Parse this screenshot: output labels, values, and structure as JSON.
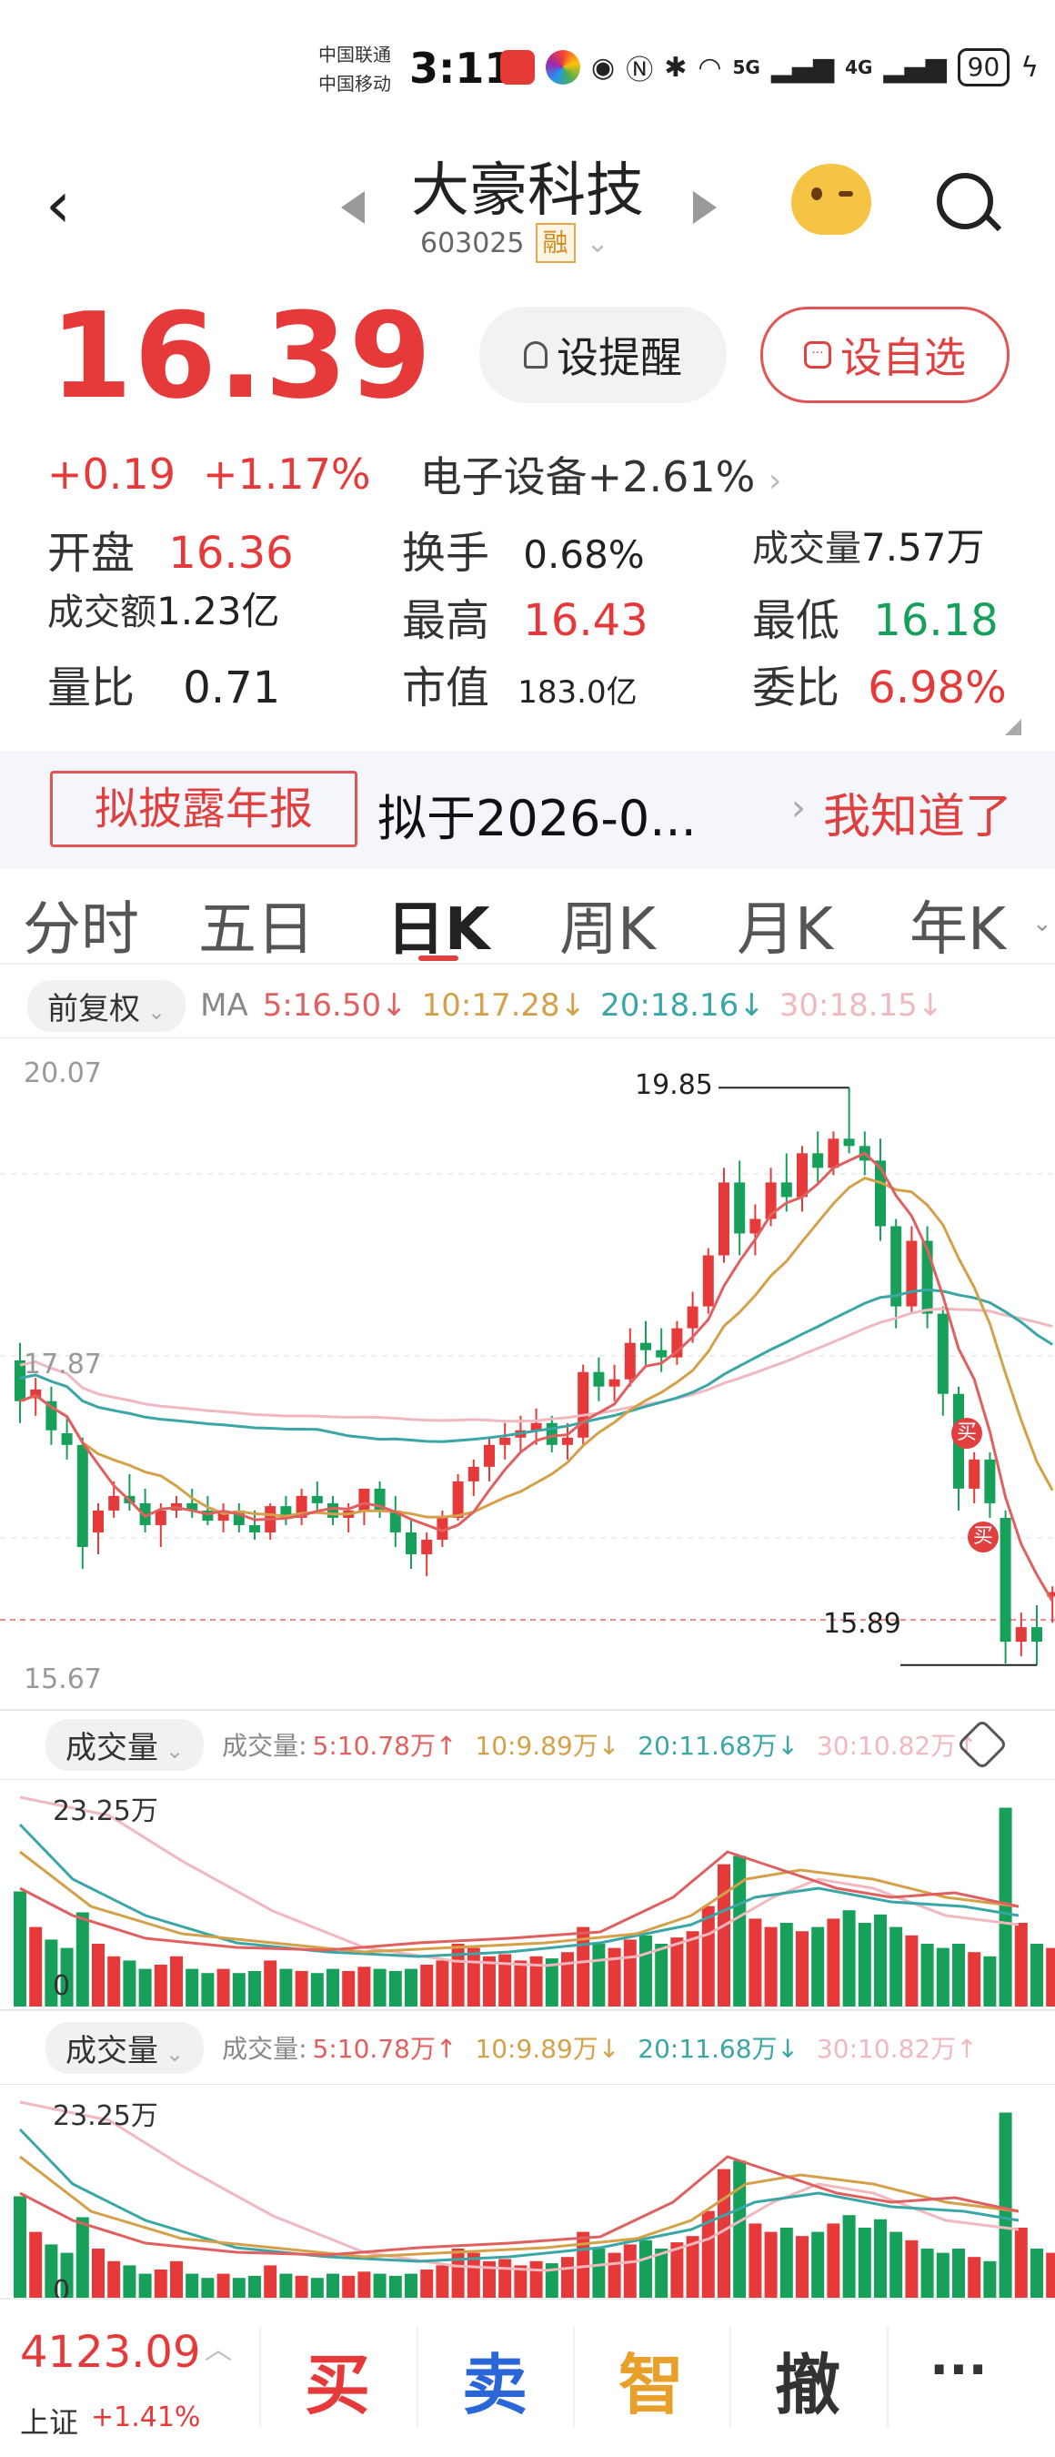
{
  "status": {
    "carrier1": "中国联通",
    "carrier2": "中国移动",
    "time": "3:11",
    "net1": "5G",
    "net2": "4G",
    "battery": "90"
  },
  "header": {
    "name": "大豪科技",
    "code": "603025",
    "badge": "融"
  },
  "quote": {
    "price": "16.39",
    "change": "+0.19",
    "change_pct": "+1.17%",
    "sector": "电子设备+2.61%",
    "remind_label": "设提醒",
    "fav_label": "设自选"
  },
  "stats": {
    "open_label": "开盘",
    "open": "16.36",
    "turnover_label": "换手",
    "turnover": "0.68%",
    "volume_label": "成交量",
    "volume": "7.57万",
    "amount_label": "成交额",
    "amount": "1.23亿",
    "high_label": "最高",
    "high": "16.43",
    "low_label": "最低",
    "low": "16.18",
    "ratio_label": "量比",
    "ratio": "0.71",
    "cap_label": "市值",
    "cap": "183.0亿",
    "commit_label": "委比",
    "commit": "6.98%"
  },
  "notice": {
    "tag": "拟披露年报",
    "text": "拟于2026-0...",
    "ok": "我知道了"
  },
  "tabs": [
    "分时",
    "五日",
    "日K",
    "周K",
    "月K",
    "年K"
  ],
  "ma": {
    "adjust": "前复权",
    "label": "MA",
    "ma5": "5:16.50↓",
    "ma10": "10:17.28↓",
    "ma20": "20:18.16↓",
    "ma30": "30:18.15↓"
  },
  "kline_labels": {
    "top": "20.07",
    "mid": "17.87",
    "bottom": "15.67",
    "high_mark": "19.85",
    "low_mark": "15.89",
    "buy": "买"
  },
  "volume": {
    "title": "成交量",
    "prefix": "成交量:",
    "v5": "5:10.78万↑",
    "v10": "10:9.89万↓",
    "v20": "20:11.68万↓",
    "v30": "30:10.82万↑",
    "max": "23.25万",
    "zero": "0"
  },
  "bottom": {
    "index_value": "4123.09",
    "index_name": "上证",
    "index_change": "+1.41%",
    "buy": "买",
    "sell": "卖",
    "smart": "智",
    "cancel": "撤",
    "more": "···"
  },
  "colors": {
    "up": "#e63a3a",
    "down": "#16a05a",
    "ma5": "#e06060",
    "ma10": "#d4a14a",
    "ma20": "#3aa6a6",
    "ma30": "#f0b8bf"
  }
}
